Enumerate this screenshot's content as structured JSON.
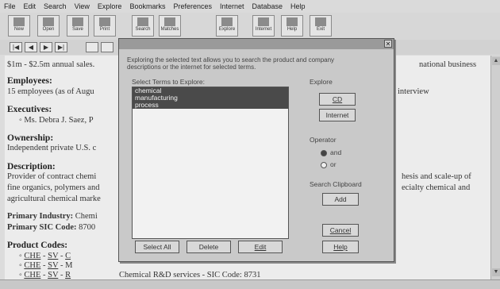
{
  "menu": [
    "File",
    "Edit",
    "Search",
    "View",
    "Explore",
    "Bookmarks",
    "Preferences",
    "Internet",
    "Database",
    "Help"
  ],
  "toolbar": [
    "New",
    "Open",
    "Save",
    "Print",
    "Search",
    "Matches",
    "Explore",
    "Internet",
    "Help",
    "Exit"
  ],
  "nav": [
    "|◀",
    "◀",
    "▶",
    "▶|"
  ],
  "document": {
    "sales": "$1m - $2.5m annual sales.",
    "sales_tail": "national business",
    "employees_heading": "Employees:",
    "employees_text": "15 employees (as of Augu",
    "employees_tail": "interview",
    "executives_heading": "Executives:",
    "executives_text": "◦ Ms. Debra J. Saez, P",
    "ownership_heading": "Ownership:",
    "ownership_text": "Independent private U.S. c",
    "description_heading": "Description:",
    "description_line1": "Provider of contract chemi",
    "description_line1_tail": "hesis and scale-up of",
    "description_line2": "fine organics, polymers and",
    "description_line2_tail": "ecialty chemical and",
    "description_line3": "agricultural chemical marke",
    "primary_industry_label": "Primary Industry:",
    "primary_industry_value": "Chemi",
    "primary_sic_label": "Primary SIC Code:",
    "primary_sic_value": "8700",
    "product_codes_heading": "Product Codes:",
    "product_codes": [
      {
        "a": "CHE",
        "b": "SV",
        "c": "C"
      },
      {
        "a": "CHE",
        "b": "SV",
        "c": "M"
      },
      {
        "a": "CHE",
        "b": "SV",
        "c": "R"
      }
    ],
    "footer_line": "Chemical R&D services - SIC Code: 8731"
  },
  "dialog": {
    "description": "Exploring the selected text allows you to search the product and company descriptions or the internet for selected terms.",
    "list_label": "Select Terms to Explore:",
    "terms": [
      "chemical",
      "manufacturing",
      "process"
    ],
    "explore_label": "Explore",
    "cd_button": "CD",
    "internet_button": "Internet",
    "operator_label": "Operator",
    "and_label": "and",
    "or_label": "or",
    "operator_selected": "and",
    "clipboard_label": "Search Clipboard",
    "add_button": "Add",
    "cancel_button": "Cancel",
    "help_button": "Help",
    "select_all_button": "Select All",
    "delete_button": "Delete",
    "edit_button": "Edit"
  }
}
